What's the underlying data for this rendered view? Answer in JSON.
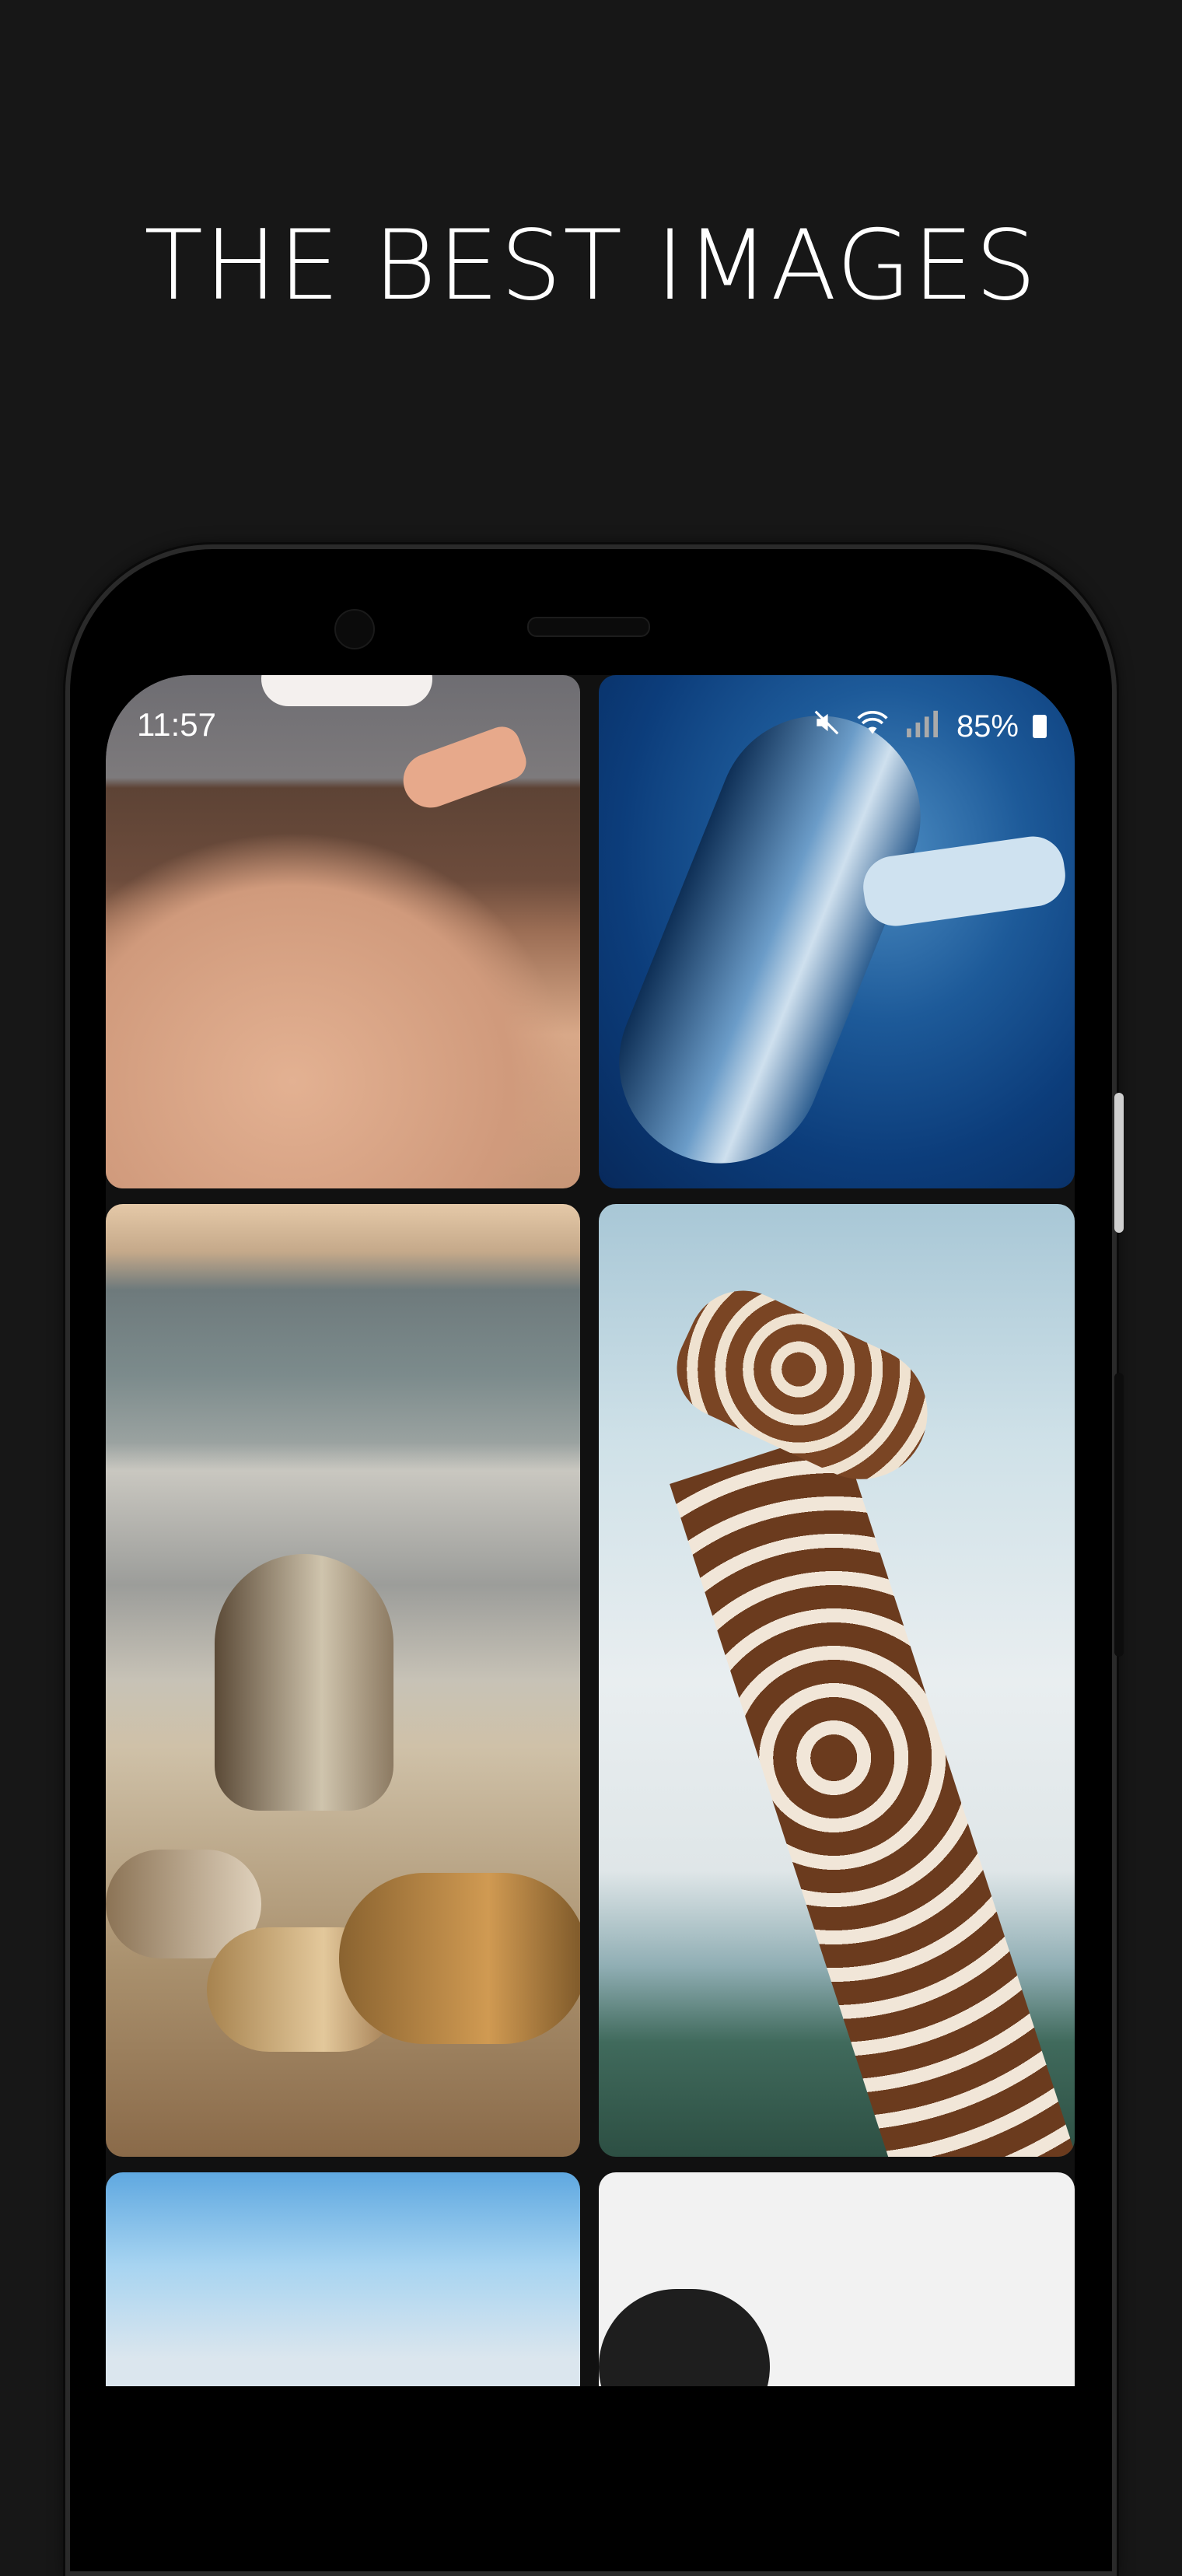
{
  "headline": "THE BEST IMAGES",
  "status_bar": {
    "time": "11:57",
    "battery": "85%",
    "icons": [
      "mute-icon",
      "wifi-icon",
      "signal-icon",
      "battery-icon"
    ]
  },
  "grid": {
    "items": [
      {
        "subject": "hand feeding seagull"
      },
      {
        "subject": "humpback whale underwater"
      },
      {
        "subject": "sea lions on beach"
      },
      {
        "subject": "giraffe head and neck"
      },
      {
        "subject": "sky"
      },
      {
        "subject": "monochrome portrait"
      }
    ]
  },
  "colors": {
    "background": "#171717",
    "text": "#ffffff",
    "phone_body": "#000000"
  }
}
